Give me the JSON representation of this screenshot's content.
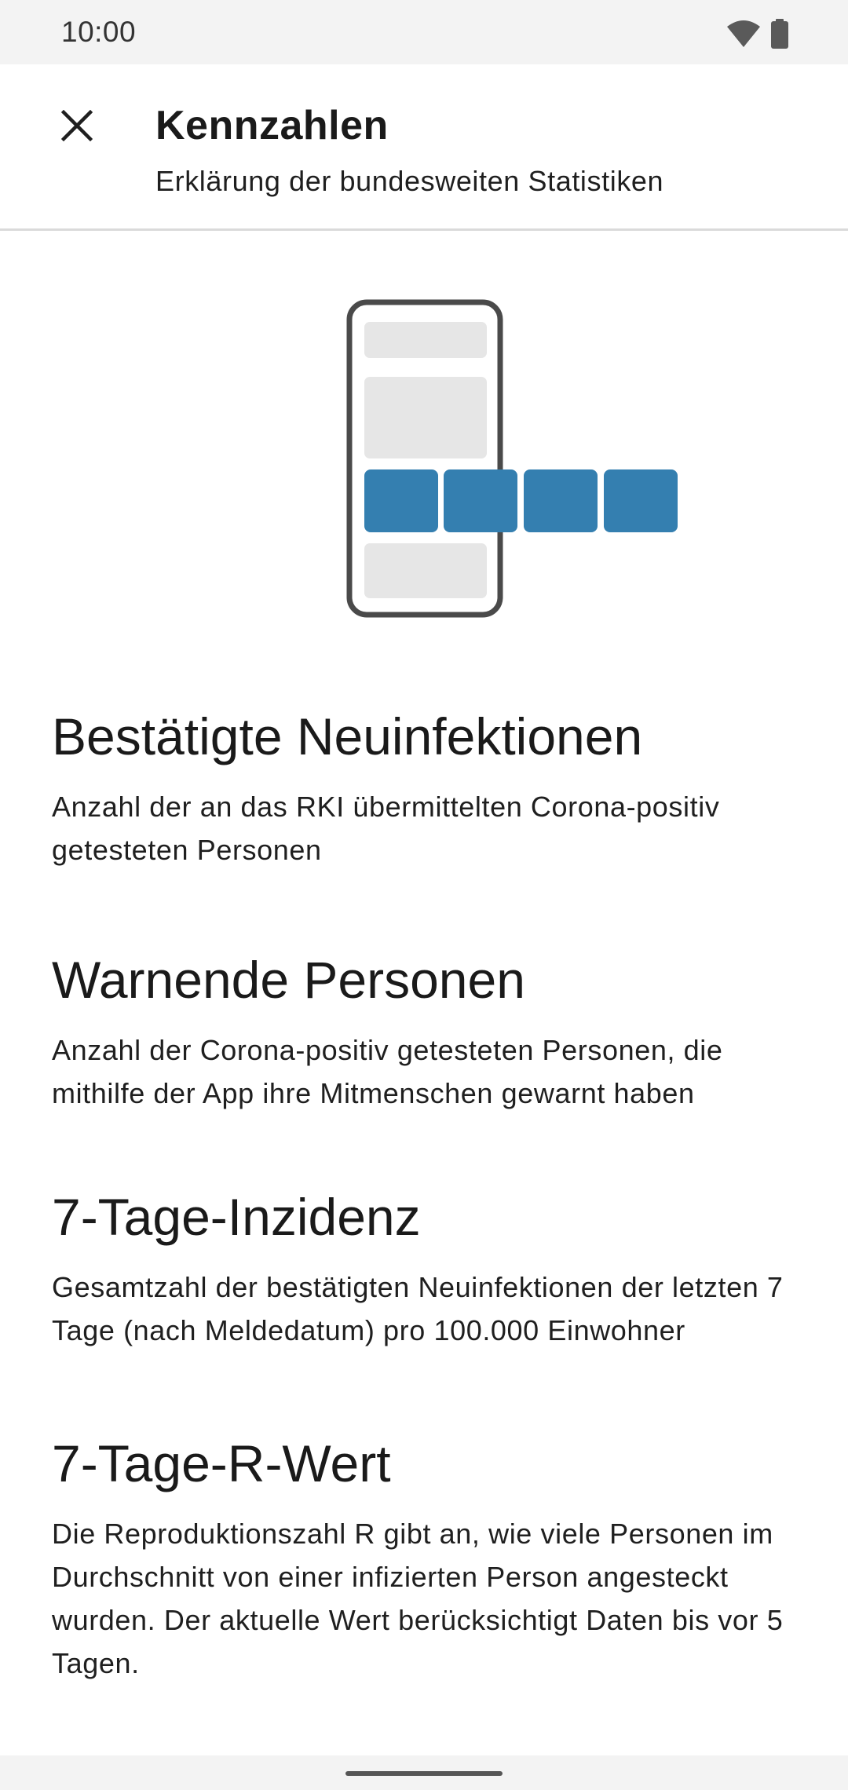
{
  "status_bar": {
    "time": "10:00",
    "icons": [
      "wifi-icon",
      "battery-icon"
    ]
  },
  "toolbar": {
    "close_icon": "close-icon",
    "title": "Kennzahlen",
    "subtitle": "Erklärung der bundesweiten Statistiken"
  },
  "illustration": {
    "icon": "phone-statistics-illustration",
    "accent_color": "#347fb0",
    "placeholder_color": "#e6e6e6",
    "frame_color": "#4a4a4a"
  },
  "sections": [
    {
      "heading": "Bestätigte Neuinfektionen",
      "body": "Anzahl der an das RKI übermittelten Corona-positiv getesteten Personen"
    },
    {
      "heading": "Warnende Personen",
      "body": "Anzahl der Corona-positiv getesteten Personen, die mithilfe der App ihre Mitmenschen gewarnt haben"
    },
    {
      "heading": "7-Tage-Inzidenz",
      "body": "Gesamtzahl der bestätigten Neuinfektionen der letzten 7 Tage (nach Meldedatum) pro 100.000 Einwohner"
    },
    {
      "heading": "7-Tage-R-Wert",
      "body": "Die Reproduktionszahl R gibt an, wie viele Personen im Durchschnitt von einer infizierten Person angesteckt wurden. Der aktuelle Wert berücksichtigt Daten bis vor 5 Tagen."
    }
  ]
}
